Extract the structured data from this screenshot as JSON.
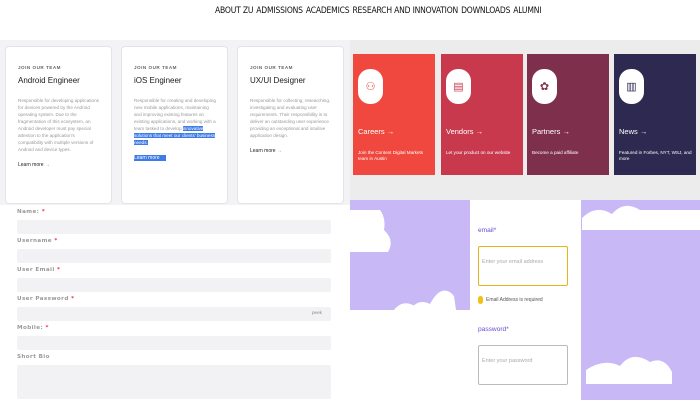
{
  "nav": {
    "items": [
      "ABOUT ZU",
      "ADMISSIONS",
      "ACADEMICS",
      "RESEARCH AND INNOVATION",
      "DOWNLOADS",
      "ALUMNI"
    ]
  },
  "jobs": {
    "cards": [
      {
        "kicker": "JOIN OUR TEAM",
        "title": "Android Engineer",
        "desc": "Responsible for developing applications for devices powered by the Android operating system. Due to the fragmentation of this ecosystem, an Android developer must pay special attention to the application's compatibility with multiple versions of Android and device types.",
        "desc_highlight": "",
        "more": "Learn more"
      },
      {
        "kicker": "JOIN OUR TEAM",
        "title": "iOS Engineer",
        "desc": "Responsible for creating and developing new mobile applications, maintaining and improving existing features on existing applications, and working with a team tasked to develop ",
        "desc_highlight": "innovative solutions that meet our clients' business needs.",
        "more": "Learn more"
      },
      {
        "kicker": "JOIN OUR TEAM",
        "title": "UX/UI Designer",
        "desc": "Responsible for collecting, researching, investigating and evaluating user requirements. Their responsibility is to deliver an outstanding user experience providing an exceptional and intuitive application design.",
        "desc_highlight": "",
        "more": "Learn more"
      }
    ]
  },
  "tiles": [
    {
      "name": "Careers",
      "desc": "Join the Content Digital Markets team in Austin",
      "color": "#f0483e",
      "icon": "careers-icon",
      "glyph": "⚇"
    },
    {
      "name": "Vendors",
      "desc": "Let your product on our website",
      "color": "#c8394e",
      "icon": "vendors-icon",
      "glyph": "▤"
    },
    {
      "name": "Partners",
      "desc": "Become a paid affiliate",
      "color": "#7e2f4b",
      "icon": "partners-icon",
      "glyph": "✿"
    },
    {
      "name": "News",
      "desc": "Featured in Forbes, NYT, WSJ, and more",
      "color": "#2e2950",
      "icon": "news-icon",
      "glyph": "▥"
    }
  ],
  "form": {
    "name_label": "Name:",
    "username_label": "Username",
    "email_label": "User Email",
    "password_label": "User Password",
    "mobile_label": "Mobile:",
    "bio_label": "Short Bio",
    "required_mark": "*",
    "eye_text": "peek"
  },
  "login": {
    "email_label": "email*",
    "email_placeholder": "Enter your email address",
    "email_error": "Email Address is required",
    "password_label": "password*",
    "password_placeholder": "Enter your password"
  }
}
